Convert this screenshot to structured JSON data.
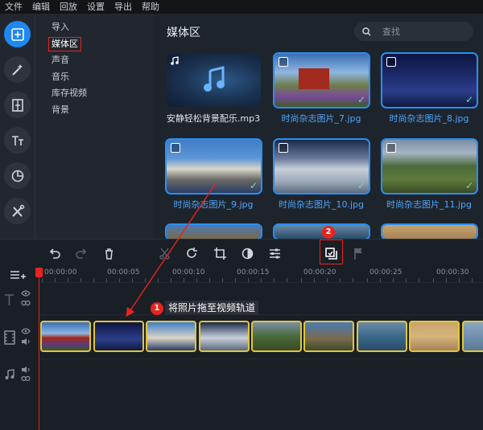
{
  "menu": [
    "文件",
    "编辑",
    "回放",
    "设置",
    "导出",
    "帮助"
  ],
  "rail": [
    {
      "icon": "add-media-icon",
      "active": true
    },
    {
      "icon": "magic-wand-icon",
      "active": false
    },
    {
      "icon": "transition-icon",
      "active": false
    },
    {
      "icon": "text-icon",
      "active": false
    },
    {
      "icon": "sticker-icon",
      "active": false
    },
    {
      "icon": "tools-icon",
      "active": false
    }
  ],
  "categories": [
    "导入",
    "媒体区",
    "声音",
    "音乐",
    "库存视频",
    "背景"
  ],
  "selected_category": "媒体区",
  "media": {
    "title": "媒体区",
    "search_placeholder": "查找",
    "items": [
      {
        "label": "安静轻松背景配乐.mp3",
        "type": "audio",
        "selected": false
      },
      {
        "label": "时尚杂志图片_7.jpg",
        "type": "image",
        "selected": true
      },
      {
        "label": "时尚杂志图片_8.jpg",
        "type": "image",
        "selected": true
      },
      {
        "label": "时尚杂志图片_9.jpg",
        "type": "image",
        "selected": true
      },
      {
        "label": "时尚杂志图片_10.jpg",
        "type": "image",
        "selected": true
      },
      {
        "label": "时尚杂志图片_11.jpg",
        "type": "image",
        "selected": true
      }
    ]
  },
  "toolbar": [
    "undo-icon",
    "redo-icon",
    "delete-icon",
    "cut-icon",
    "rotate-icon",
    "crop-icon",
    "color-icon",
    "adjust-icon",
    "properties-icon",
    "flag-icon"
  ],
  "ruler": [
    "00:00:00",
    "00:00:05",
    "00:00:10",
    "00:00:15",
    "00:00:20",
    "00:00:25",
    "00:00:30"
  ],
  "annotations": {
    "step1_number": "1",
    "step1_text": "将照片拖至视频轨道",
    "step2_number": "2"
  },
  "colors": {
    "accent": "#1f87f0",
    "highlight": "#e8231f",
    "clip_border": "#e2c63a"
  }
}
